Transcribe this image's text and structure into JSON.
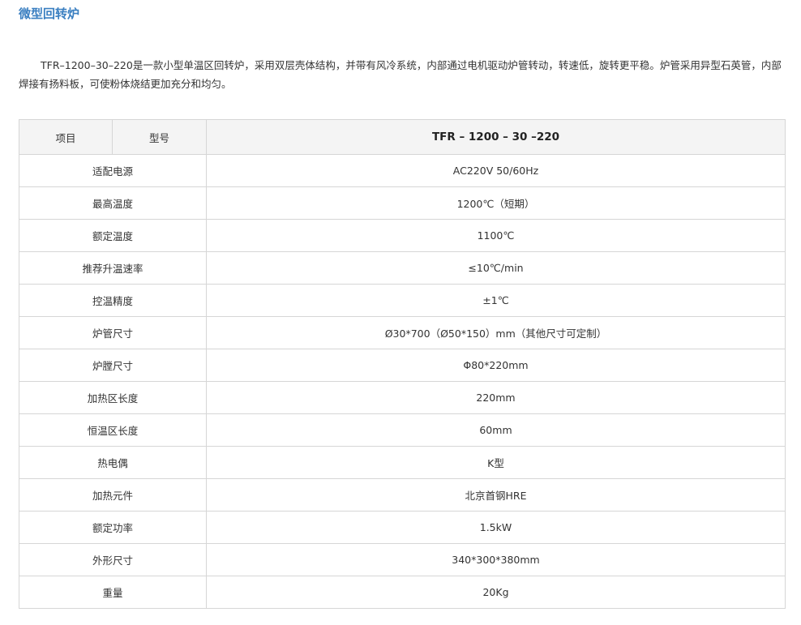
{
  "page": {
    "title": "微型回转炉",
    "intro": "TFR–1200–30–220是一款小型单温区回转炉，采用双层壳体结构，并带有风冷系统，内部通过电机驱动炉管转动，转速低，旋转更平稳。炉管采用异型石英管，内部焊接有扬料板，可使粉体烧结更加充分和均匀。"
  },
  "table": {
    "header": {
      "item_label": "项目",
      "model_label": "型号",
      "model_value": "TFR – 1200 – 30 –220"
    },
    "rows": [
      {
        "label": "适配电源",
        "value": "AC220V 50/60Hz"
      },
      {
        "label": "最高温度",
        "value": "1200℃（短期）"
      },
      {
        "label": "额定温度",
        "value": "1100℃"
      },
      {
        "label": "推荐升温速率",
        "value": "≤10℃/min"
      },
      {
        "label": "控温精度",
        "value": "±1℃"
      },
      {
        "label": "炉管尺寸",
        "value": "Ø30*700（Ø50*150）mm（其他尺寸可定制）"
      },
      {
        "label": "炉膛尺寸",
        "value": "Φ80*220mm"
      },
      {
        "label": "加热区长度",
        "value": "220mm"
      },
      {
        "label": "恒温区长度",
        "value": "60mm"
      },
      {
        "label": "热电偶",
        "value": "K型"
      },
      {
        "label": "加热元件",
        "value": "北京首钢HRE"
      },
      {
        "label": "额定功率",
        "value": "1.5kW"
      },
      {
        "label": "外形尺寸",
        "value": "340*300*380mm"
      },
      {
        "label": "重量",
        "value": "20Kg"
      }
    ]
  }
}
